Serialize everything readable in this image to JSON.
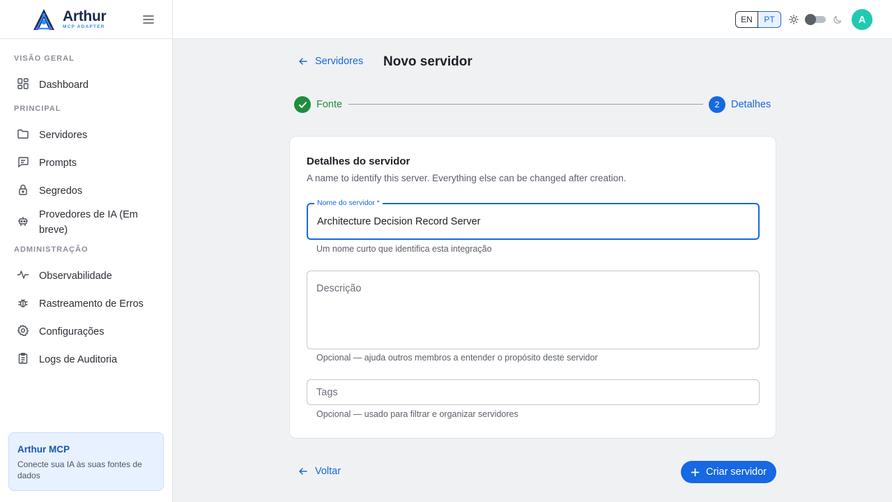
{
  "brand": {
    "name": "Arthur",
    "subtitle": "MCP ADAPTER",
    "logo_icon": "arthur-logo-icon"
  },
  "sidebar": {
    "sections": [
      {
        "title": "VISÃO GERAL",
        "items": [
          {
            "label": "Dashboard",
            "icon": "dashboard-icon"
          }
        ]
      },
      {
        "title": "PRINCIPAL",
        "items": [
          {
            "label": "Servidores",
            "icon": "folder-icon"
          },
          {
            "label": "Prompts",
            "icon": "message-icon"
          },
          {
            "label": "Segredos",
            "icon": "lock-icon"
          },
          {
            "label": "Provedores de IA (Em breve)",
            "icon": "robot-icon"
          }
        ]
      },
      {
        "title": "ADMINISTRAÇÃO",
        "items": [
          {
            "label": "Observabilidade",
            "icon": "activity-icon"
          },
          {
            "label": "Rastreamento de Erros",
            "icon": "bug-icon"
          },
          {
            "label": "Configurações",
            "icon": "gear-icon"
          },
          {
            "label": "Logs de Auditoria",
            "icon": "clipboard-icon"
          }
        ]
      }
    ],
    "promo": {
      "title": "Arthur MCP",
      "description": "Conecte sua IA às suas fontes de dados"
    }
  },
  "topbar": {
    "languages": [
      "EN",
      "PT"
    ],
    "selected_language": "PT",
    "theme": "light",
    "avatar_initial": "A",
    "avatar_color": "#1ecbb0"
  },
  "header": {
    "back_label": "Servidores",
    "title": "Novo servidor"
  },
  "stepper": {
    "steps": [
      {
        "label": "Fonte",
        "state": "done"
      },
      {
        "label": "Detalhes",
        "state": "active",
        "number": "2"
      }
    ]
  },
  "form": {
    "title": "Detalhes do servidor",
    "description": "A name to identify this server. Everything else can be changed after creation.",
    "name_field": {
      "label": "Nome do servidor *",
      "value": "Architecture Decision Record Server",
      "helper": "Um nome curto que identifica esta integração"
    },
    "description_field": {
      "placeholder": "Descrição",
      "value": "",
      "helper": "Opcional — ajuda outros membros a entender o propósito deste servidor"
    },
    "tags_field": {
      "placeholder": "Tags",
      "value": "",
      "helper": "Opcional — usado para filtrar e organizar servidores"
    }
  },
  "footer": {
    "back_label": "Voltar",
    "create_label": "Criar servidor"
  },
  "colors": {
    "primary": "#1668e3",
    "success": "#1e8e3e",
    "accent": "#1ecbb0"
  }
}
